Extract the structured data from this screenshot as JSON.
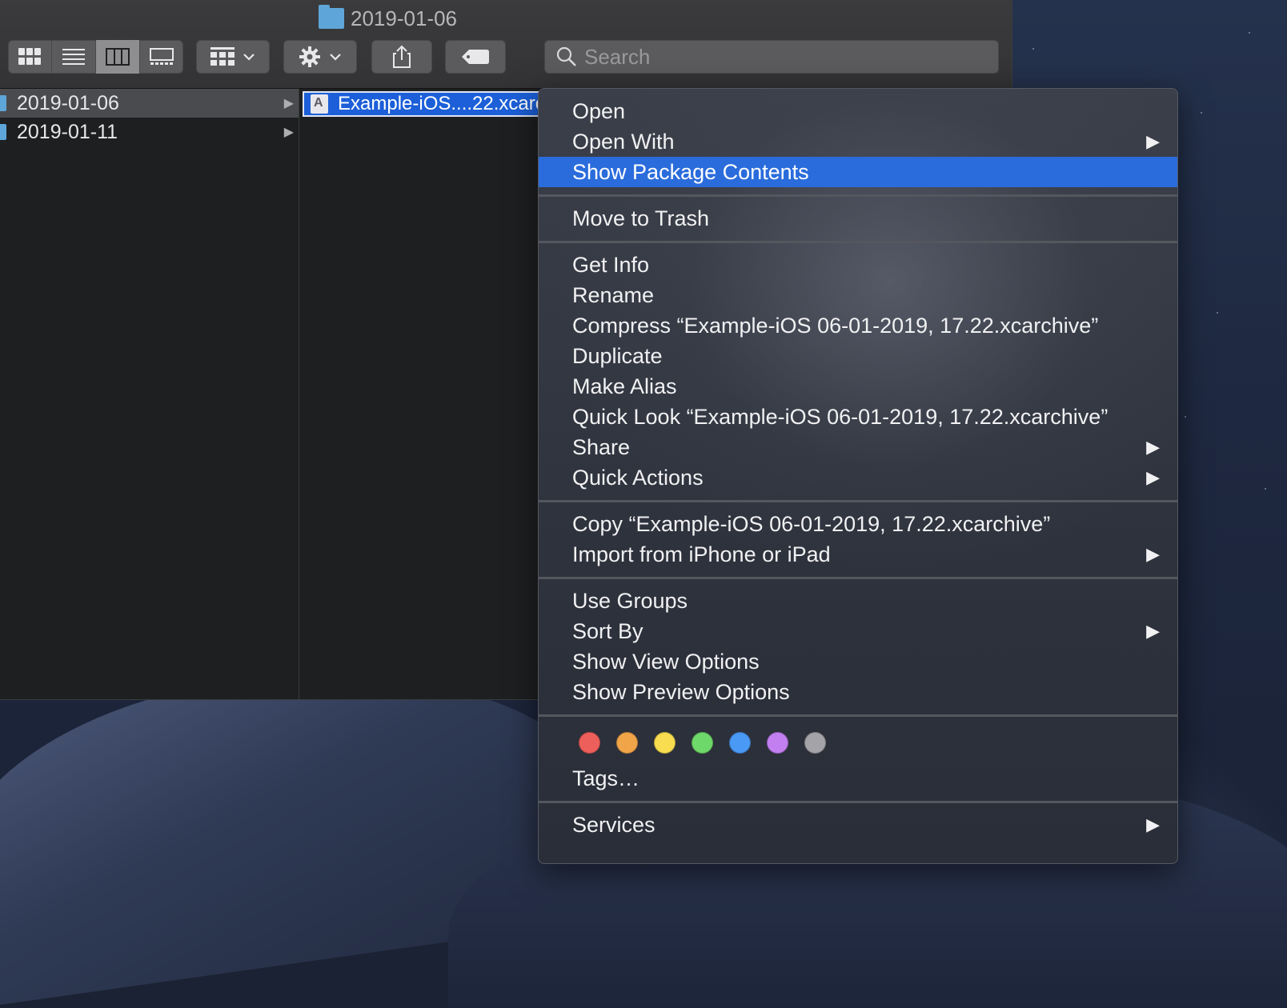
{
  "window": {
    "title": "2019-01-06"
  },
  "toolbar": {
    "view_icons": [
      "icon-view-icon",
      "list-view-icon",
      "column-view-icon",
      "gallery-view-icon"
    ],
    "active_view": 2,
    "search_placeholder": "Search"
  },
  "columns": {
    "first": [
      {
        "label": "2019-01-06",
        "selected": true
      },
      {
        "label": "2019-01-11",
        "selected": false
      }
    ],
    "second": [
      {
        "label": "Example-iOS....22.xcarchive",
        "selected": true
      }
    ]
  },
  "context_menu": {
    "groups": [
      [
        {
          "label": "Open",
          "submenu": false
        },
        {
          "label": "Open With",
          "submenu": true
        },
        {
          "label": "Show Package Contents",
          "submenu": false,
          "highlighted": true
        }
      ],
      [
        {
          "label": "Move to Trash",
          "submenu": false
        }
      ],
      [
        {
          "label": "Get Info",
          "submenu": false
        },
        {
          "label": "Rename",
          "submenu": false
        },
        {
          "label": "Compress “Example-iOS 06-01-2019, 17.22.xcarchive”",
          "submenu": false
        },
        {
          "label": "Duplicate",
          "submenu": false
        },
        {
          "label": "Make Alias",
          "submenu": false
        },
        {
          "label": "Quick Look “Example-iOS 06-01-2019, 17.22.xcarchive”",
          "submenu": false
        },
        {
          "label": "Share",
          "submenu": true
        },
        {
          "label": "Quick Actions",
          "submenu": true
        }
      ],
      [
        {
          "label": "Copy “Example-iOS 06-01-2019, 17.22.xcarchive”",
          "submenu": false
        },
        {
          "label": "Import from iPhone or iPad",
          "submenu": true
        }
      ],
      [
        {
          "label": "Use Groups",
          "submenu": false
        },
        {
          "label": "Sort By",
          "submenu": true
        },
        {
          "label": "Show View Options",
          "submenu": false
        },
        {
          "label": "Show Preview Options",
          "submenu": false
        }
      ]
    ],
    "tag_colors": [
      "#ec5f5a",
      "#f1a549",
      "#f7dd4f",
      "#6fd86a",
      "#4a99f4",
      "#c27ff0",
      "#a4a4a8"
    ],
    "tags_label": "Tags…",
    "services_label": "Services",
    "submenu_arrow": "▶"
  }
}
